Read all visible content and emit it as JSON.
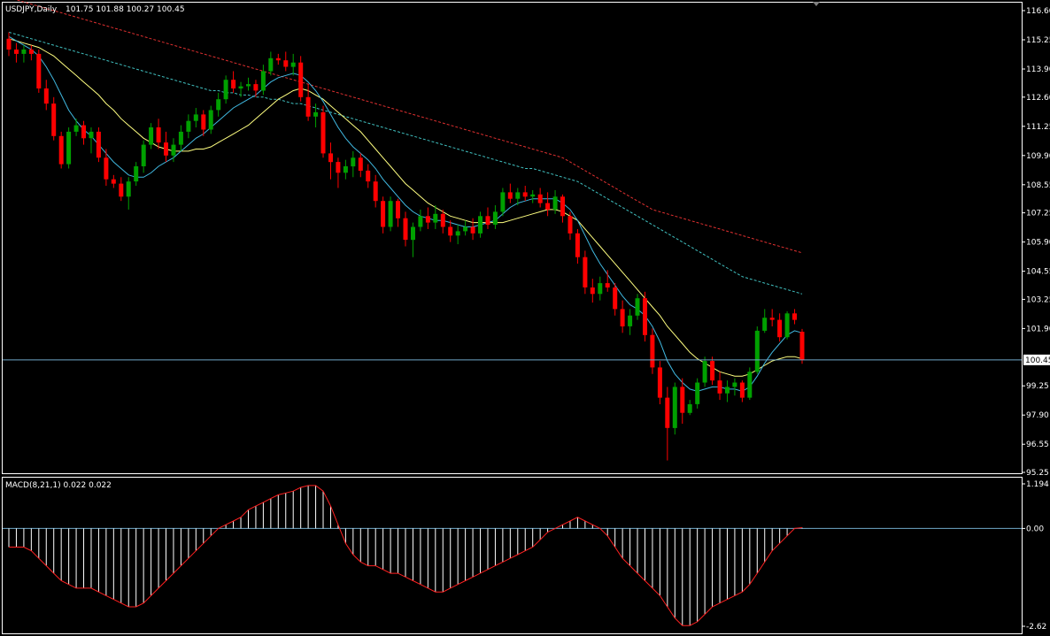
{
  "colors": {
    "background": "#000000",
    "frame": "#ffffff",
    "bull": "#00a000",
    "bear": "#ff0000",
    "ma_fast": "#40b8e0",
    "ma_mid": "#ffff80",
    "ma_slow_dash": "#40c0c0",
    "ma_long": "#e03030",
    "price_line": "#6fa8c8",
    "macd_hist": "#ffffff",
    "macd_signal": "#ff2020"
  },
  "header": {
    "symbol": "USDJPY,Daily",
    "ohlc": "101.75 101.88 100.27 100.45"
  },
  "current_price": "100.45",
  "chart_data": [
    {
      "type": "candlestick",
      "title": "USDJPY,Daily",
      "ylim": [
        95.25,
        116.6
      ],
      "yticks": [
        "116.60",
        "115.25",
        "113.90",
        "112.60",
        "111.25",
        "109.90",
        "108.55",
        "107.25",
        "105.90",
        "104.55",
        "103.25",
        "101.90",
        "99.25",
        "97.90",
        "96.55",
        "95.25"
      ],
      "last_price": 100.45,
      "candles": [
        [
          115.3,
          115.6,
          114.5,
          114.8
        ],
        [
          114.8,
          115.1,
          114.2,
          114.6
        ],
        [
          114.6,
          115.0,
          114.2,
          114.8
        ],
        [
          114.8,
          115.0,
          114.3,
          114.6
        ],
        [
          114.6,
          114.8,
          112.8,
          113.0
        ],
        [
          113.0,
          113.4,
          112.0,
          112.3
        ],
        [
          112.3,
          112.6,
          110.6,
          110.8
        ],
        [
          110.8,
          111.0,
          109.3,
          109.5
        ],
        [
          109.5,
          111.2,
          109.3,
          111.0
        ],
        [
          111.0,
          111.6,
          110.8,
          111.3
        ],
        [
          111.3,
          111.5,
          110.4,
          110.7
        ],
        [
          110.7,
          111.2,
          110.0,
          111.0
        ],
        [
          111.0,
          111.2,
          109.6,
          109.8
        ],
        [
          109.8,
          110.2,
          108.5,
          108.8
        ],
        [
          108.8,
          109.0,
          108.4,
          108.6
        ],
        [
          108.6,
          108.9,
          107.8,
          108.0
        ],
        [
          108.0,
          108.9,
          107.4,
          108.7
        ],
        [
          108.7,
          109.6,
          108.5,
          109.4
        ],
        [
          109.4,
          110.6,
          109.1,
          110.4
        ],
        [
          110.4,
          111.4,
          110.2,
          111.2
        ],
        [
          111.2,
          111.6,
          110.2,
          110.5
        ],
        [
          110.5,
          111.0,
          109.6,
          109.9
        ],
        [
          109.9,
          110.7,
          109.6,
          110.4
        ],
        [
          110.4,
          111.3,
          110.1,
          111.0
        ],
        [
          111.0,
          111.8,
          110.7,
          111.5
        ],
        [
          111.5,
          112.1,
          111.2,
          111.8
        ],
        [
          111.8,
          112.0,
          110.8,
          111.1
        ],
        [
          111.1,
          112.2,
          110.9,
          112.0
        ],
        [
          112.0,
          112.8,
          111.7,
          112.5
        ],
        [
          112.5,
          113.6,
          112.3,
          113.4
        ],
        [
          113.4,
          113.8,
          112.8,
          113.0
        ],
        [
          113.0,
          113.3,
          112.6,
          113.1
        ],
        [
          113.1,
          113.5,
          112.9,
          113.2
        ],
        [
          113.2,
          113.4,
          112.6,
          112.9
        ],
        [
          112.9,
          114.1,
          112.7,
          113.8
        ],
        [
          113.8,
          114.7,
          113.6,
          114.4
        ],
        [
          114.4,
          114.6,
          114.1,
          114.3
        ],
        [
          114.3,
          114.7,
          113.8,
          114.0
        ],
        [
          114.0,
          114.6,
          113.6,
          114.2
        ],
        [
          114.2,
          114.5,
          112.4,
          112.6
        ],
        [
          112.6,
          113.2,
          111.5,
          111.7
        ],
        [
          111.7,
          112.3,
          111.2,
          111.9
        ],
        [
          111.9,
          112.2,
          109.8,
          110.0
        ],
        [
          110.0,
          110.5,
          108.8,
          109.6
        ],
        [
          109.6,
          109.8,
          108.4,
          109.1
        ],
        [
          109.1,
          109.7,
          108.8,
          109.4
        ],
        [
          109.4,
          110.1,
          108.9,
          109.8
        ],
        [
          109.8,
          110.0,
          108.9,
          109.2
        ],
        [
          109.2,
          109.5,
          108.4,
          108.7
        ],
        [
          108.7,
          109.0,
          107.5,
          107.8
        ],
        [
          107.8,
          108.0,
          106.3,
          106.6
        ],
        [
          106.6,
          108.0,
          106.4,
          107.8
        ],
        [
          107.8,
          107.9,
          106.6,
          107.0
        ],
        [
          107.0,
          107.3,
          105.7,
          106.0
        ],
        [
          106.0,
          106.8,
          105.2,
          106.6
        ],
        [
          106.6,
          107.4,
          106.4,
          107.1
        ],
        [
          107.1,
          107.5,
          106.5,
          106.8
        ],
        [
          106.8,
          107.6,
          106.5,
          107.2
        ],
        [
          107.2,
          107.4,
          106.3,
          106.6
        ],
        [
          106.6,
          106.9,
          105.9,
          106.2
        ],
        [
          106.2,
          106.7,
          105.8,
          106.4
        ],
        [
          106.4,
          106.9,
          106.2,
          106.6
        ],
        [
          106.6,
          107.0,
          106.0,
          106.3
        ],
        [
          106.3,
          107.3,
          106.1,
          107.1
        ],
        [
          107.1,
          107.5,
          106.5,
          106.7
        ],
        [
          106.7,
          107.6,
          106.5,
          107.3
        ],
        [
          107.3,
          108.4,
          107.1,
          108.2
        ],
        [
          108.2,
          108.6,
          107.7,
          107.9
        ],
        [
          107.9,
          108.4,
          107.6,
          108.2
        ],
        [
          108.2,
          108.5,
          107.8,
          108.0
        ],
        [
          108.0,
          108.3,
          107.7,
          108.1
        ],
        [
          108.1,
          108.4,
          107.5,
          107.7
        ],
        [
          107.7,
          108.2,
          107.1,
          107.4
        ],
        [
          107.4,
          108.3,
          107.2,
          108.0
        ],
        [
          108.0,
          108.1,
          106.8,
          107.1
        ],
        [
          107.1,
          107.3,
          106.0,
          106.3
        ],
        [
          106.3,
          106.5,
          104.9,
          105.2
        ],
        [
          105.2,
          105.5,
          103.5,
          103.8
        ],
        [
          103.8,
          104.2,
          103.1,
          103.5
        ],
        [
          103.5,
          104.3,
          103.2,
          104.0
        ],
        [
          104.0,
          104.6,
          103.6,
          103.8
        ],
        [
          103.8,
          104.0,
          102.5,
          102.8
        ],
        [
          102.8,
          103.2,
          101.7,
          102.0
        ],
        [
          102.0,
          102.8,
          101.6,
          102.5
        ],
        [
          102.5,
          103.5,
          102.3,
          103.3
        ],
        [
          103.3,
          103.6,
          101.3,
          101.6
        ],
        [
          101.6,
          101.9,
          99.8,
          100.1
        ],
        [
          100.1,
          100.4,
          98.4,
          98.7
        ],
        [
          98.7,
          99.2,
          95.8,
          97.3
        ],
        [
          97.3,
          99.4,
          97.0,
          99.2
        ],
        [
          99.2,
          99.6,
          97.5,
          98.0
        ],
        [
          98.0,
          98.6,
          97.9,
          98.4
        ],
        [
          98.4,
          99.6,
          98.2,
          99.4
        ],
        [
          99.4,
          100.6,
          99.2,
          100.4
        ],
        [
          100.4,
          100.6,
          99.3,
          99.5
        ],
        [
          99.5,
          99.9,
          98.6,
          98.9
        ],
        [
          98.9,
          99.5,
          98.5,
          99.2
        ],
        [
          99.2,
          99.6,
          98.8,
          99.4
        ],
        [
          99.4,
          99.5,
          98.5,
          98.7
        ],
        [
          98.7,
          100.1,
          98.6,
          99.9
        ],
        [
          99.9,
          102.0,
          99.8,
          101.8
        ],
        [
          101.8,
          102.8,
          101.7,
          102.4
        ],
        [
          102.4,
          102.8,
          102.0,
          102.3
        ],
        [
          102.3,
          102.6,
          101.3,
          101.5
        ],
        [
          101.5,
          102.7,
          101.4,
          102.6
        ],
        [
          102.6,
          102.8,
          102.1,
          102.3
        ],
        [
          101.75,
          101.88,
          100.27,
          100.45
        ]
      ],
      "ma": {
        "fast": [
          115.4,
          115.2,
          115.0,
          114.8,
          114.5,
          114.0,
          113.4,
          112.7,
          112.0,
          111.5,
          111.1,
          110.8,
          110.4,
          110.0,
          109.6,
          109.3,
          109.0,
          108.9,
          108.9,
          109.1,
          109.4,
          109.6,
          109.8,
          110.1,
          110.4,
          110.7,
          110.9,
          111.2,
          111.5,
          111.8,
          112.1,
          112.3,
          112.5,
          112.7,
          113.0,
          113.3,
          113.5,
          113.6,
          113.7,
          113.6,
          113.3,
          112.9,
          112.4,
          111.8,
          111.2,
          110.7,
          110.3,
          110.0,
          109.7,
          109.3,
          108.8,
          108.4,
          108.0,
          107.6,
          107.3,
          107.1,
          107.0,
          106.9,
          106.9,
          106.8,
          106.7,
          106.6,
          106.6,
          106.7,
          106.8,
          106.9,
          107.2,
          107.5,
          107.7,
          107.8,
          107.9,
          107.9,
          107.9,
          107.9,
          107.7,
          107.4,
          106.9,
          106.2,
          105.5,
          104.9,
          104.4,
          103.9,
          103.4,
          103.0,
          102.8,
          102.5,
          102.0,
          101.3,
          100.4,
          99.8,
          99.4,
          99.1,
          99.0,
          99.1,
          99.2,
          99.2,
          99.1,
          99.1,
          99.0,
          99.2,
          99.7,
          100.3,
          100.8,
          101.2,
          101.6,
          101.8,
          101.7
        ],
        "mid": [
          115.3,
          115.2,
          115.1,
          115.0,
          114.9,
          114.7,
          114.5,
          114.2,
          113.9,
          113.6,
          113.3,
          113.0,
          112.7,
          112.3,
          112.0,
          111.6,
          111.3,
          111.0,
          110.7,
          110.5,
          110.3,
          110.2,
          110.1,
          110.1,
          110.1,
          110.2,
          110.2,
          110.3,
          110.5,
          110.7,
          110.9,
          111.1,
          111.3,
          111.6,
          111.9,
          112.2,
          112.5,
          112.7,
          112.9,
          113.0,
          112.9,
          112.7,
          112.5,
          112.2,
          111.9,
          111.6,
          111.3,
          111.0,
          110.6,
          110.2,
          109.8,
          109.4,
          109.0,
          108.6,
          108.3,
          108.0,
          107.7,
          107.5,
          107.3,
          107.1,
          107.0,
          106.9,
          106.8,
          106.8,
          106.8,
          106.8,
          106.8,
          106.9,
          107.0,
          107.1,
          107.2,
          107.3,
          107.4,
          107.4,
          107.3,
          107.1,
          106.9,
          106.5,
          106.1,
          105.7,
          105.3,
          104.9,
          104.5,
          104.1,
          103.7,
          103.3,
          102.9,
          102.5,
          102.0,
          101.6,
          101.2,
          100.8,
          100.5,
          100.3,
          100.1,
          99.9,
          99.8,
          99.7,
          99.7,
          99.8,
          100.0,
          100.2,
          100.4,
          100.5,
          100.6,
          100.6,
          100.5
        ],
        "slow": [
          115.6,
          115.5,
          115.4,
          115.3,
          115.2,
          115.1,
          115.0,
          114.9,
          114.8,
          114.7,
          114.6,
          114.5,
          114.4,
          114.3,
          114.2,
          114.1,
          114.0,
          113.9,
          113.8,
          113.7,
          113.6,
          113.5,
          113.4,
          113.3,
          113.2,
          113.1,
          113.0,
          112.9,
          112.9,
          112.8,
          112.8,
          112.7,
          112.7,
          112.6,
          112.6,
          112.5,
          112.5,
          112.4,
          112.3,
          112.3,
          112.2,
          112.1,
          112.0,
          111.9,
          111.8,
          111.7,
          111.6,
          111.5,
          111.4,
          111.3,
          111.2,
          111.1,
          111.0,
          110.9,
          110.8,
          110.7,
          110.6,
          110.5,
          110.4,
          110.3,
          110.2,
          110.1,
          110.0,
          109.9,
          109.8,
          109.7,
          109.6,
          109.5,
          109.4,
          109.3,
          109.3,
          109.2,
          109.1,
          109.0,
          108.9,
          108.8,
          108.7,
          108.5,
          108.3,
          108.1,
          107.9,
          107.7,
          107.5,
          107.3,
          107.1,
          106.9,
          106.7,
          106.5,
          106.3,
          106.1,
          105.9,
          105.7,
          105.5,
          105.3,
          105.1,
          104.9,
          104.7,
          104.5,
          104.3,
          104.2,
          104.1,
          104.0,
          103.9,
          103.8,
          103.7,
          103.6,
          103.5
        ],
        "long": [
          117.2,
          117.1,
          117.0,
          116.9,
          116.8,
          116.7,
          116.6,
          116.5,
          116.4,
          116.3,
          116.2,
          116.1,
          116.0,
          115.9,
          115.8,
          115.7,
          115.6,
          115.5,
          115.4,
          115.3,
          115.2,
          115.1,
          115.0,
          114.9,
          114.8,
          114.7,
          114.6,
          114.5,
          114.4,
          114.3,
          114.2,
          114.1,
          114.0,
          113.9,
          113.8,
          113.7,
          113.6,
          113.5,
          113.4,
          113.3,
          113.2,
          113.1,
          113.0,
          112.9,
          112.8,
          112.7,
          112.6,
          112.5,
          112.4,
          112.3,
          112.2,
          112.1,
          112.0,
          111.9,
          111.8,
          111.7,
          111.6,
          111.5,
          111.4,
          111.3,
          111.2,
          111.1,
          111.0,
          110.9,
          110.8,
          110.7,
          110.6,
          110.5,
          110.4,
          110.3,
          110.2,
          110.1,
          110.0,
          109.9,
          109.8,
          109.6,
          109.4,
          109.2,
          109.0,
          108.8,
          108.6,
          108.4,
          108.2,
          108.0,
          107.8,
          107.6,
          107.4,
          107.3,
          107.2,
          107.1,
          107.0,
          106.9,
          106.8,
          106.7,
          106.6,
          106.5,
          106.4,
          106.3,
          106.2,
          106.1,
          106.0,
          105.9,
          105.8,
          105.7,
          105.6,
          105.5,
          105.4
        ]
      }
    },
    {
      "type": "bar",
      "title": "MACD(8,21,1) 0.022 0.022",
      "ylim": [
        -2.62,
        1.194
      ],
      "yticks": [
        "1.194",
        "0.00",
        "-2.62"
      ],
      "values": [
        -0.5,
        -0.5,
        -0.5,
        -0.6,
        -0.8,
        -1.0,
        -1.2,
        -1.4,
        -1.5,
        -1.6,
        -1.6,
        -1.6,
        -1.7,
        -1.8,
        -1.9,
        -2.0,
        -2.1,
        -2.1,
        -2.0,
        -1.8,
        -1.6,
        -1.4,
        -1.2,
        -1.0,
        -0.8,
        -0.6,
        -0.4,
        -0.2,
        0.0,
        0.1,
        0.2,
        0.3,
        0.5,
        0.6,
        0.7,
        0.8,
        0.9,
        0.95,
        1.0,
        1.1,
        1.15,
        1.15,
        1.0,
        0.6,
        0.1,
        -0.4,
        -0.7,
        -0.9,
        -1.0,
        -1.0,
        -1.1,
        -1.2,
        -1.2,
        -1.3,
        -1.4,
        -1.5,
        -1.6,
        -1.7,
        -1.7,
        -1.6,
        -1.5,
        -1.4,
        -1.3,
        -1.2,
        -1.1,
        -1.0,
        -0.9,
        -0.8,
        -0.7,
        -0.6,
        -0.5,
        -0.3,
        -0.1,
        0.0,
        0.1,
        0.2,
        0.3,
        0.2,
        0.1,
        0.0,
        -0.2,
        -0.5,
        -0.8,
        -1.0,
        -1.2,
        -1.4,
        -1.6,
        -1.8,
        -2.1,
        -2.4,
        -2.6,
        -2.6,
        -2.5,
        -2.3,
        -2.1,
        -2.0,
        -1.9,
        -1.8,
        -1.7,
        -1.5,
        -1.2,
        -0.9,
        -0.6,
        -0.4,
        -0.2,
        0.0,
        0.022
      ]
    }
  ]
}
